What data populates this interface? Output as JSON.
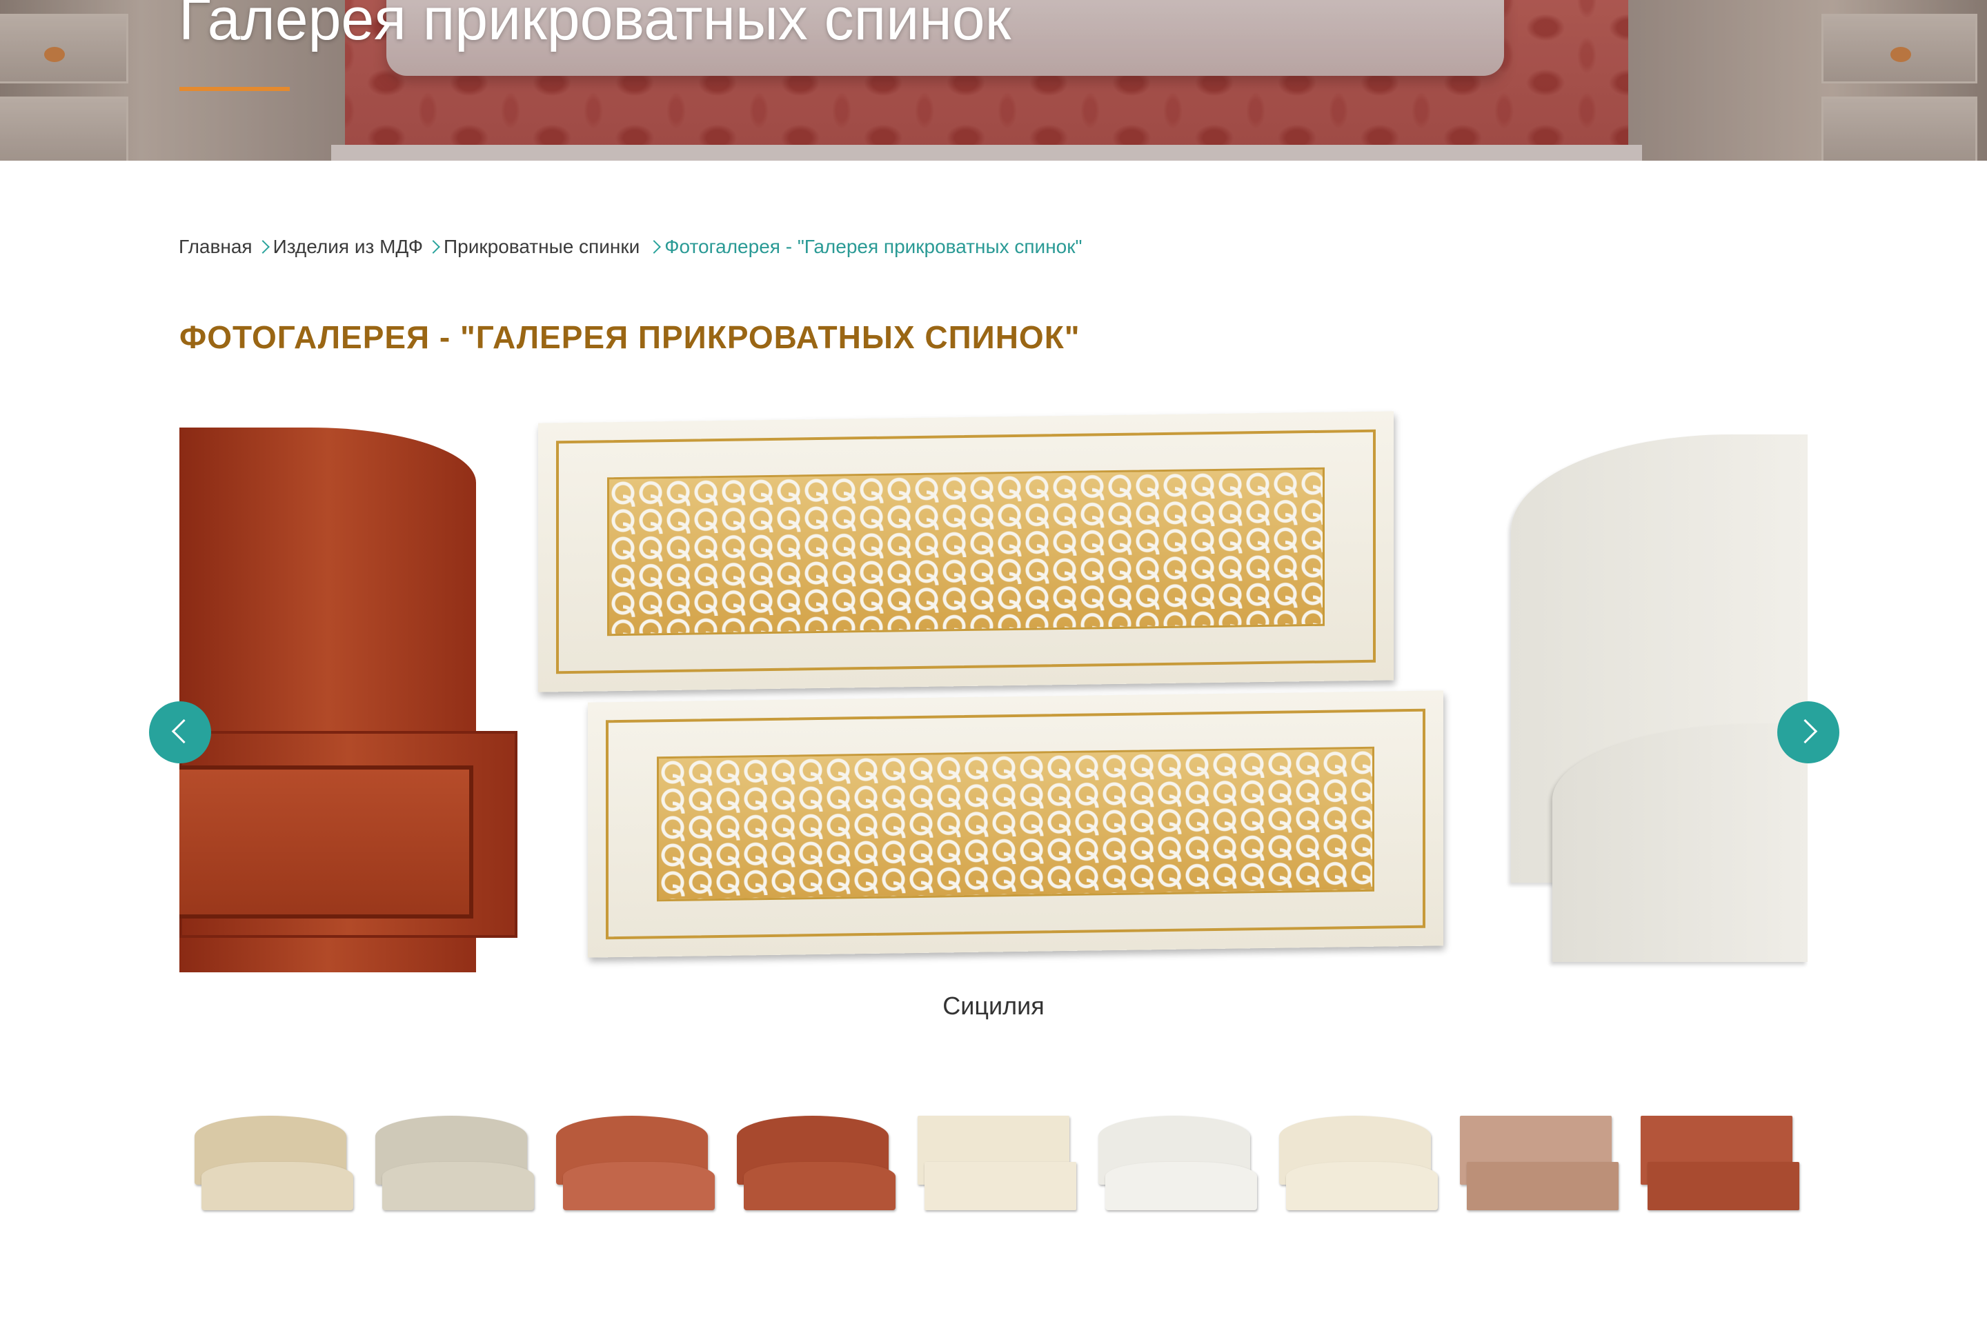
{
  "hero": {
    "title": "Галерея прикроватных спинок",
    "underline_color": "#e58a2e"
  },
  "breadcrumb": {
    "items": [
      "Главная",
      "Изделия из МДФ",
      "Прикроватные спинки"
    ],
    "current": "Фотогалерея - \"Галерея прикроватных спинок\""
  },
  "page": {
    "heading": "ФОТОГАЛЕРЕЯ - \"ГАЛЕРЕЯ ПРИКРОВАТНЫХ СПИНОК\""
  },
  "slider": {
    "caption": "Сицилия",
    "prev_icon": "chevron-left-icon",
    "next_icon": "chevron-right-icon",
    "accent": "#27a39c"
  },
  "thumbnails": [
    {
      "top": "#d9c9a6",
      "bottom": "#e4d8bd",
      "style": "arched"
    },
    {
      "top": "#cfc9b8",
      "bottom": "#d8d2c1",
      "style": "arched"
    },
    {
      "top": "#b85a3c",
      "bottom": "#c2664a",
      "style": "arched"
    },
    {
      "top": "#a8492e",
      "bottom": "#b35437",
      "style": "arched"
    },
    {
      "top": "#efe7d2",
      "bottom": "#f1e9d6",
      "style": "flat"
    },
    {
      "top": "#ecebe5",
      "bottom": "#f2f1ec",
      "style": "arched"
    },
    {
      "top": "#eee6d2",
      "bottom": "#f2ebd9",
      "style": "arched"
    },
    {
      "top": "#c89f8a",
      "bottom": "#bc9078",
      "style": "flat"
    },
    {
      "top": "#b4553a",
      "bottom": "#a94b30",
      "style": "flat"
    }
  ],
  "colors": {
    "heading": "#9a6614",
    "breadcrumb_current": "#2a9a95",
    "text": "#3b3b3b"
  }
}
